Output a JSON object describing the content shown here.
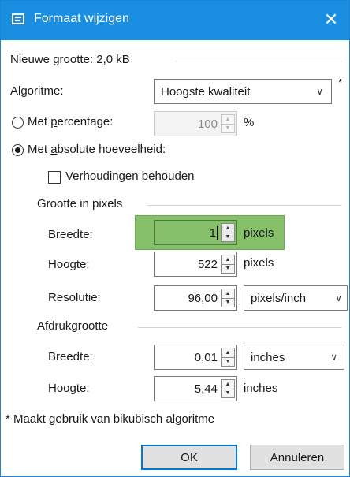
{
  "window": {
    "title": "Formaat wijzigen",
    "close": "✕"
  },
  "new_size": {
    "label": "Nieuwe grootte: 2,0 kB"
  },
  "algorithm": {
    "label": "Algoritme:",
    "value": "Hoogste kwaliteit",
    "asterisk": "*"
  },
  "percentage": {
    "label_pre": "Met ",
    "label_u": "p",
    "label_post": "ercentage:",
    "value": "100",
    "unit": "%",
    "selected": false
  },
  "absolute": {
    "label_pre": "Met ",
    "label_u": "a",
    "label_post": "bsolute hoeveelheid:",
    "selected": true
  },
  "keep_ratio": {
    "label_pre": "Verhoudingen ",
    "label_u": "b",
    "label_post": "ehouden",
    "checked": false
  },
  "pixel_size": {
    "header": "Grootte in pixels",
    "width": {
      "label": "Breedte:",
      "value": "1",
      "unit": "pixels"
    },
    "height": {
      "label": "Hoogte:",
      "value": "522",
      "unit": "pixels"
    },
    "resolution": {
      "label": "Resolutie:",
      "value": "96,00",
      "unit": "pixels/inch"
    }
  },
  "print_size": {
    "header": "Afdrukgrootte",
    "width": {
      "label": "Breedte:",
      "value": "0,01",
      "unit": "inches"
    },
    "height": {
      "label": "Hoogte:",
      "value": "5,44",
      "unit": "inches"
    }
  },
  "footnote": "* Maakt gebruik van bikubisch algoritme",
  "buttons": {
    "ok": "OK",
    "cancel": "Annuleren"
  },
  "colors": {
    "titlebar": "#1a8ee1",
    "highlight": "#86c06a",
    "primary_border": "#0078d7"
  }
}
